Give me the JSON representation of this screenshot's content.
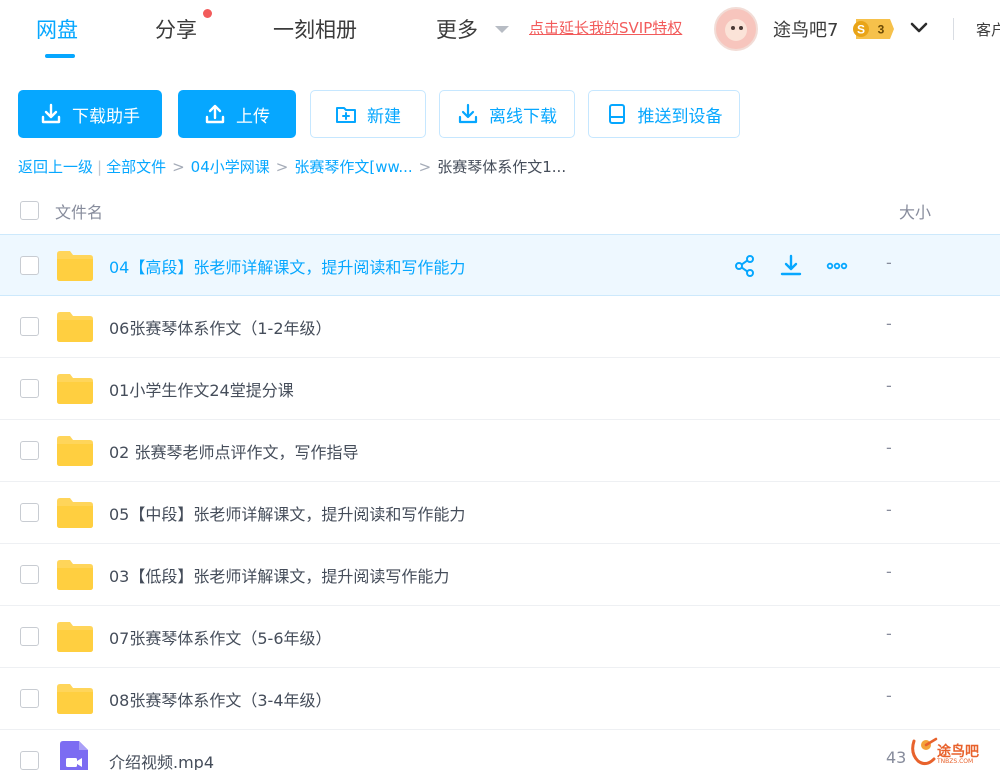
{
  "nav": {
    "tabs": [
      {
        "label": "网盘",
        "active": true
      },
      {
        "label": "分享",
        "badge_dot": true
      },
      {
        "label": "一刻相册"
      },
      {
        "label": "更多"
      }
    ],
    "promo_link": "点击延长我的SVIP特权",
    "user": {
      "name": "途鸟吧7",
      "vip_level": "3",
      "vip_symbol": "S"
    },
    "service_label": "客户"
  },
  "toolbar": {
    "buttons": [
      {
        "label": "下载助手",
        "icon": "download-icon",
        "style": "primary"
      },
      {
        "label": "上传",
        "icon": "upload-icon",
        "style": "primary"
      },
      {
        "label": "新建",
        "icon": "new-folder-icon",
        "style": "secondary"
      },
      {
        "label": "离线下载",
        "icon": "offline-download-icon",
        "style": "secondary"
      },
      {
        "label": "推送到设备",
        "icon": "device-icon",
        "style": "secondary"
      }
    ]
  },
  "breadcrumb": {
    "back": "返回上一级",
    "items": [
      "全部文件",
      "04小学网课",
      "张赛琴作文[ww..."
    ],
    "current": "张赛琴体系作文1..."
  },
  "table": {
    "col_name": "文件名",
    "col_size": "大小"
  },
  "files": [
    {
      "name": "04【高段】张老师详解课文，提升阅读和写作能力",
      "size": "-",
      "type": "folder",
      "hovered": true
    },
    {
      "name": "06张赛琴体系作文（1-2年级）",
      "size": "-",
      "type": "folder"
    },
    {
      "name": "01小学生作文24堂提分课",
      "size": "-",
      "type": "folder"
    },
    {
      "name": "02 张赛琴老师点评作文，写作指导",
      "size": "-",
      "type": "folder"
    },
    {
      "name": "05【中段】张老师详解课文，提升阅读和写作能力",
      "size": "-",
      "type": "folder"
    },
    {
      "name": "03【低段】张老师详解课文，提升阅读写作能力",
      "size": "-",
      "type": "folder"
    },
    {
      "name": "07张赛琴体系作文（5-6年级）",
      "size": "-",
      "type": "folder"
    },
    {
      "name": "08张赛琴体系作文（3-4年级）",
      "size": "-",
      "type": "folder"
    },
    {
      "name": "介绍视频.mp4",
      "size": "43",
      "type": "video"
    }
  ],
  "row_actions": [
    "share-icon",
    "download-icon",
    "more-icon"
  ],
  "watermark": {
    "text": "途鸟吧",
    "sub": "TNBZS.COM"
  },
  "colors": {
    "accent": "#06a7ff",
    "promo": "#f25b5b",
    "folder": "#ffd55a",
    "video": "#7c6cf2"
  }
}
